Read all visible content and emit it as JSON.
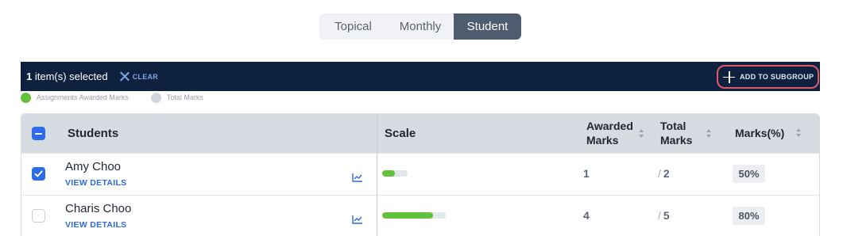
{
  "tabs": [
    {
      "label": "Topical",
      "active": false
    },
    {
      "label": "Monthly",
      "active": false
    },
    {
      "label": "Student",
      "active": true
    }
  ],
  "selection": {
    "count": "1",
    "suffix": " item(s) selected",
    "clear_label": "CLEAR",
    "add_label": "ADD TO SUBGROUP"
  },
  "legend": {
    "awarded_label": "Assignments Awarded Marks",
    "total_label": "Total Marks",
    "colors": {
      "awarded": "#62c23c",
      "total": "#cfd4dd"
    }
  },
  "table": {
    "headers": {
      "students": "Students",
      "scale": "Scale",
      "awarded_line1": "Awarded",
      "awarded_line2": "Marks",
      "total_line1": "Total",
      "total_line2": "Marks",
      "percent": "Marks(%)"
    },
    "select_all_state": "indeterminate",
    "view_details_label": "VIEW DETAILS",
    "rows": [
      {
        "name": "Amy Choo",
        "checked": true,
        "awarded": "1",
        "total": "2",
        "percent": "50%",
        "scale_fraction": 0.5
      },
      {
        "name": "Charis Choo",
        "checked": false,
        "awarded": "4",
        "total": "5",
        "percent": "80%",
        "scale_fraction": 0.8
      }
    ]
  },
  "colors": {
    "header_bar": "#0e213f",
    "accent_blue": "#2c6ce6",
    "highlight_red": "#e1586a",
    "active_tab": "#4f5b6e"
  }
}
